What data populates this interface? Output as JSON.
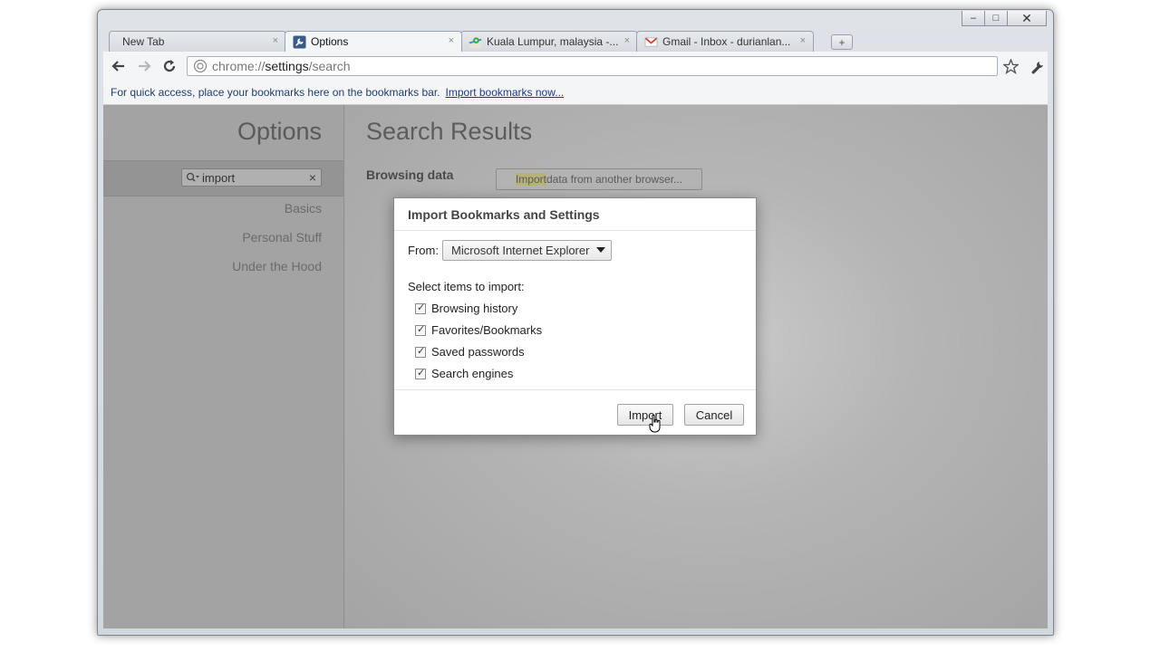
{
  "tabs": [
    {
      "label": "New Tab",
      "favicon": "none",
      "active": false
    },
    {
      "label": "Options",
      "favicon": "wrench-icon",
      "active": true
    },
    {
      "label": "Kuala Lumpur, malaysia -...",
      "favicon": "google-maps-icon",
      "active": false
    },
    {
      "label": "Gmail - Inbox - durianlan...",
      "favicon": "gmail-icon",
      "active": false
    }
  ],
  "tab_close_glyph": "×",
  "new_tab_glyph": "+",
  "window_controls": {
    "minimize": "–",
    "maximize": "□",
    "close": "✕"
  },
  "omnibox": {
    "scheme": "chrome://",
    "host": "settings",
    "path": "/search"
  },
  "bookmark_bar": {
    "message": "For quick access, place your bookmarks here on the bookmarks bar.",
    "link": "Import bookmarks now..."
  },
  "sidebar": {
    "title": "Options",
    "search_value": "import",
    "search_clear": "×",
    "items": [
      "Basics",
      "Personal Stuff",
      "Under the Hood"
    ]
  },
  "main": {
    "title": "Search Results",
    "section_label": "Browsing data",
    "import_button": {
      "highlight": "Import",
      "rest": " data from another browser..."
    }
  },
  "dialog": {
    "title": "Import Bookmarks and Settings",
    "from_label": "From:",
    "from_value": "Microsoft Internet Explorer",
    "select_label": "Select items to import:",
    "items": [
      {
        "label": "Browsing history",
        "checked": true
      },
      {
        "label": "Favorites/Bookmarks",
        "checked": true
      },
      {
        "label": "Saved passwords",
        "checked": true
      },
      {
        "label": "Search engines",
        "checked": true
      }
    ],
    "import_label": "Import",
    "cancel_label": "Cancel"
  },
  "colors": {
    "frame": "#d2d7de",
    "overlay": "#a5a5a5",
    "gmail_red": "#d44638",
    "maps_green": "#34a853"
  }
}
